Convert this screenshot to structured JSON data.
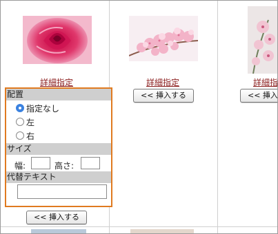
{
  "gallery": {
    "columns": [
      {
        "link_label": "詳細指定",
        "insert_label": "<< 挿入する"
      },
      {
        "link_label": "詳細指定",
        "insert_label": "<< 挿入する"
      },
      {
        "link_label": "詳細指定",
        "insert_label": "<< 挿入する"
      }
    ]
  },
  "options_panel": {
    "placement": {
      "heading": "配置",
      "options": [
        {
          "label": "指定なし",
          "checked": true
        },
        {
          "label": "左",
          "checked": false
        },
        {
          "label": "右",
          "checked": false
        }
      ]
    },
    "size": {
      "heading": "サイズ",
      "width_label": "幅:",
      "width_value": "",
      "height_label": "高さ:",
      "height_value": ""
    },
    "alt_text": {
      "heading": "代替テキスト",
      "value": ""
    }
  },
  "bottom_insert_label": "<< 挿入する",
  "colors": {
    "highlight_border": "#e07a1f",
    "link": "#8b1d1d",
    "radio_selected": "#3b82e0",
    "section_header_bg": "#cfcfcf"
  }
}
